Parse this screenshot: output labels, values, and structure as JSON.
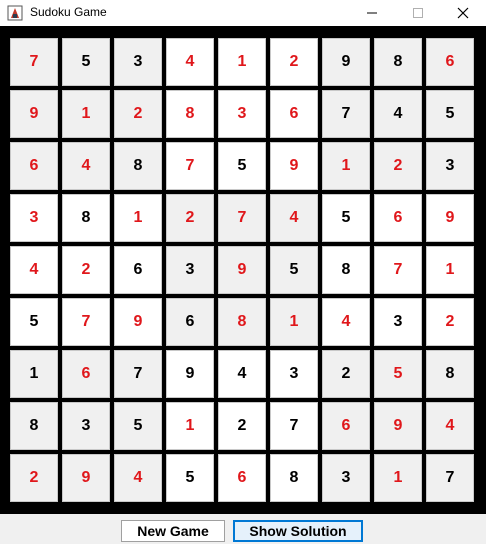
{
  "window": {
    "title": "Sudoku Game",
    "icon": "sudoku-app-icon",
    "controls": [
      "minimize-icon",
      "maximize-icon",
      "close-icon"
    ]
  },
  "board": {
    "rows": [
      [
        7,
        5,
        3,
        4,
        1,
        2,
        9,
        8,
        6
      ],
      [
        9,
        1,
        2,
        8,
        3,
        6,
        7,
        4,
        5
      ],
      [
        6,
        4,
        8,
        7,
        5,
        9,
        1,
        2,
        3
      ],
      [
        3,
        8,
        1,
        2,
        7,
        4,
        5,
        6,
        9
      ],
      [
        4,
        2,
        6,
        3,
        9,
        5,
        8,
        7,
        1
      ],
      [
        5,
        7,
        9,
        6,
        8,
        1,
        4,
        3,
        2
      ],
      [
        1,
        6,
        7,
        9,
        4,
        3,
        2,
        5,
        8
      ],
      [
        8,
        3,
        5,
        1,
        2,
        7,
        6,
        9,
        4
      ],
      [
        2,
        9,
        4,
        5,
        6,
        8,
        3,
        1,
        7
      ]
    ],
    "red_cells": [
      [
        1,
        0,
        0,
        1,
        1,
        1,
        0,
        0,
        1
      ],
      [
        1,
        1,
        1,
        1,
        1,
        1,
        0,
        0,
        0
      ],
      [
        1,
        1,
        0,
        1,
        0,
        1,
        1,
        1,
        0
      ],
      [
        1,
        0,
        1,
        1,
        1,
        1,
        0,
        1,
        1
      ],
      [
        1,
        1,
        0,
        0,
        1,
        0,
        0,
        1,
        1
      ],
      [
        0,
        1,
        1,
        0,
        1,
        1,
        1,
        0,
        1
      ],
      [
        0,
        1,
        0,
        0,
        0,
        0,
        0,
        1,
        0
      ],
      [
        0,
        0,
        0,
        1,
        0,
        0,
        1,
        1,
        1
      ],
      [
        1,
        1,
        1,
        0,
        1,
        0,
        0,
        1,
        0
      ]
    ],
    "colors": {
      "red_digit": "#e0171b",
      "black_digit": "#000000",
      "shaded_box": "#f0f0f0",
      "white_box": "#ffffff"
    }
  },
  "buttons": {
    "new_game": "New Game",
    "show_solution": "Show Solution"
  }
}
